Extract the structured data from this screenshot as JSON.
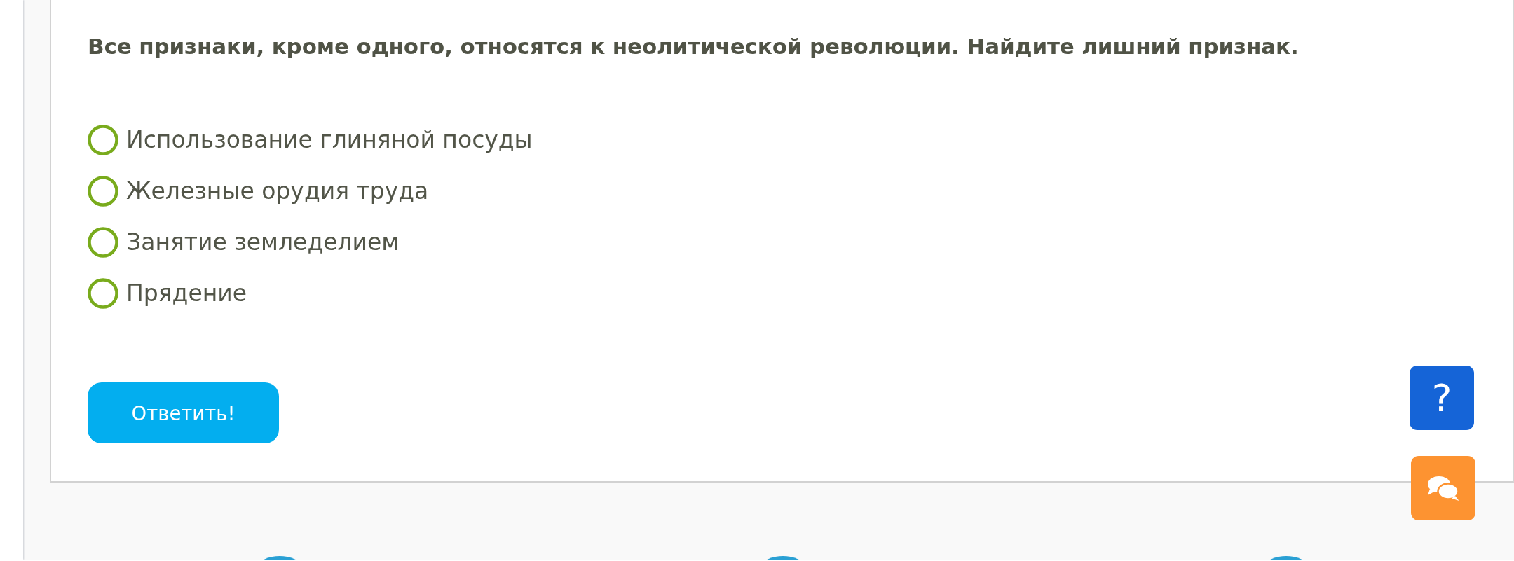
{
  "question": {
    "text": "Все признаки, кроме одного, относятся к неолитической революции. Найдите лишний признак."
  },
  "options": [
    {
      "label": "Использование глиняной посуды",
      "selected": false
    },
    {
      "label": "Железные орудия труда",
      "selected": false
    },
    {
      "label": "Занятие земледелием",
      "selected": false
    },
    {
      "label": "Прядение",
      "selected": false
    }
  ],
  "submit_button": {
    "label": "Ответить!"
  },
  "help_button": {
    "label": "?"
  }
}
